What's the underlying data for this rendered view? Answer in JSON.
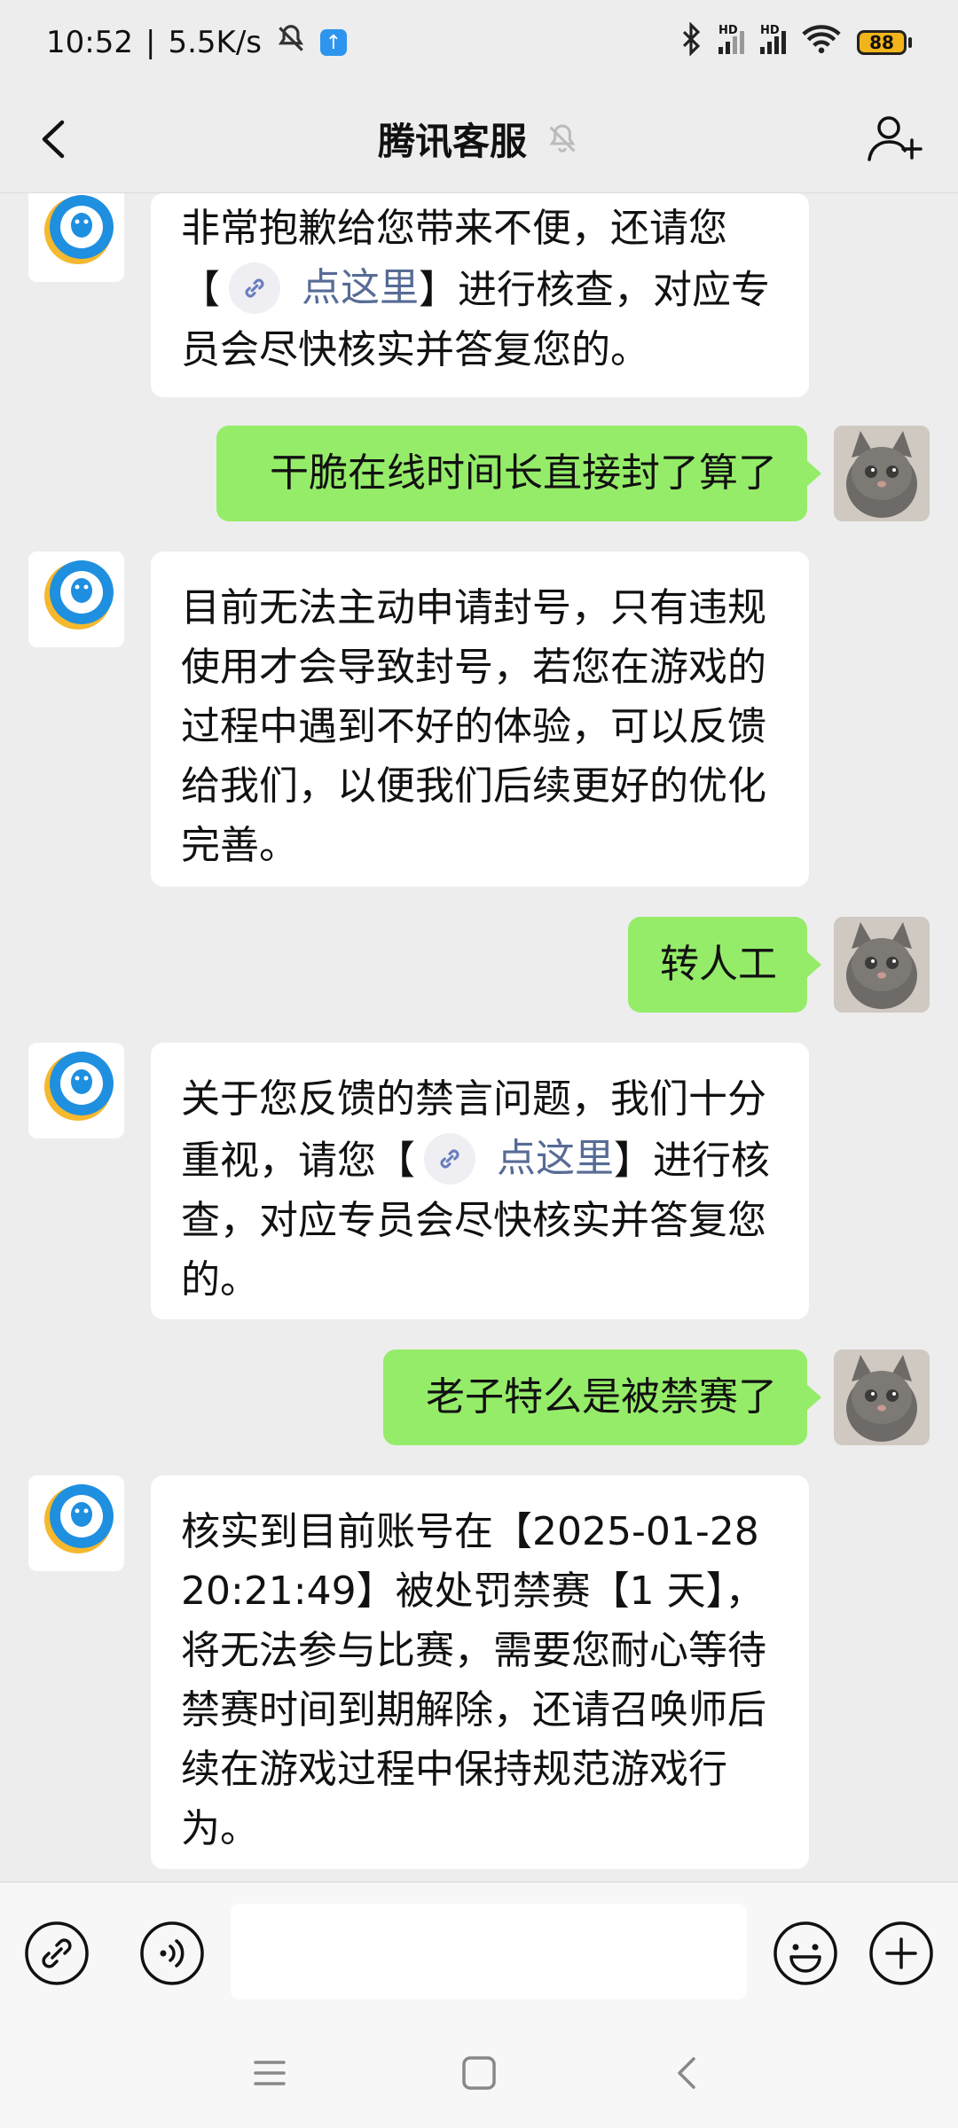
{
  "status_bar": {
    "time": "10:52",
    "speed": "5.5K/s",
    "battery": "88",
    "network_label_1": "HD",
    "network_label_2": "HD"
  },
  "header": {
    "title": "腾讯客服"
  },
  "messages": [
    {
      "from": "bot",
      "parts": [
        "非常抱歉给您带来不便，还请您",
        "【",
        "点这里",
        "】进行核查，对应专员会尽快核实并答复您的。"
      ]
    },
    {
      "from": "me",
      "text": "干脆在线时间长直接封了算了"
    },
    {
      "from": "bot",
      "text": "目前无法主动申请封号，只有违规使用才会导致封号，若您在游戏的过程中遇到不好的体验，可以反馈给我们，以便我们后续更好的优化完善。"
    },
    {
      "from": "me",
      "text": "转人工"
    },
    {
      "from": "bot",
      "parts": [
        "关于您反馈的禁言问题，我们十分重视，请您",
        "【",
        "点这里",
        "】进行核查，对应专员会尽快核实并答复您的。"
      ]
    },
    {
      "from": "me",
      "text": "老子特么是被禁赛了"
    },
    {
      "from": "bot",
      "text": "核实到目前账号在【2025-01-28 20:21:49】被处罚禁赛【1 天】，将无法参与比赛，需要您耐心等待禁赛时间到期解除，还请召唤师后续在游戏过程中保持规范游戏行为。"
    }
  ],
  "input": {
    "value": ""
  },
  "colors": {
    "my_bubble": "#95ec69",
    "bot_bubble": "#ffffff",
    "link": "#576b95",
    "background": "#ededed"
  },
  "icons": [
    "back-arrow-icon",
    "mute-bell-icon",
    "add-friend-icon",
    "link-icon",
    "voice-icon",
    "emoji-icon",
    "plus-icon",
    "menu-icon",
    "home-icon",
    "back-nav-icon"
  ]
}
